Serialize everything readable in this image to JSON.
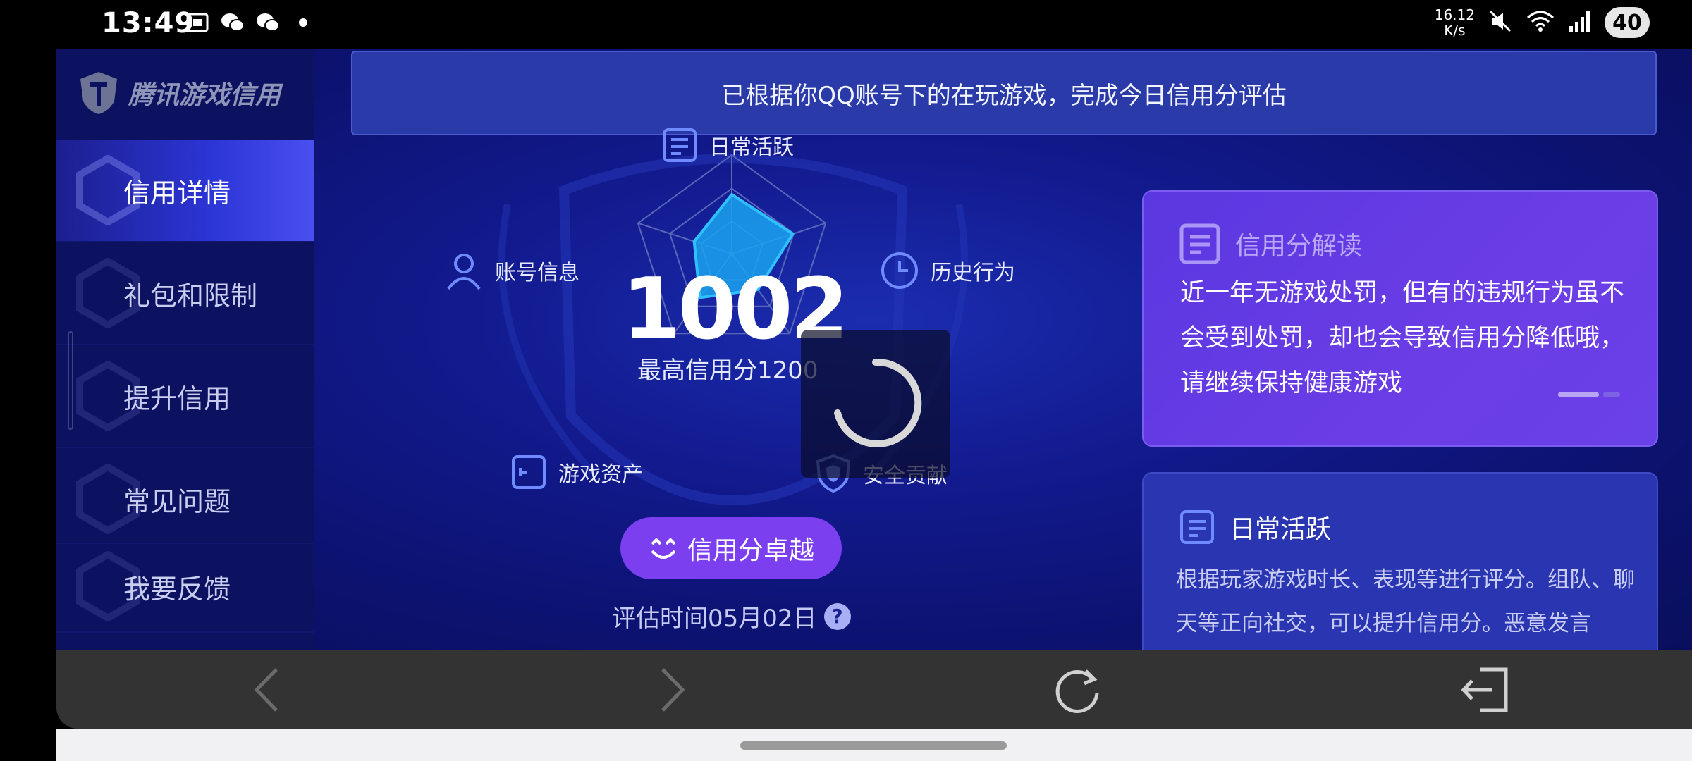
{
  "status_bar": {
    "time": "13:49",
    "net_speed_value": "16.12",
    "net_speed_unit": "K/s",
    "battery": "40",
    "icons": [
      "screenshot-icon",
      "wechat-icon",
      "wechat-icon",
      "dot-icon",
      "mute-icon",
      "wifi-icon",
      "signal-icon"
    ]
  },
  "sidebar": {
    "logo_text": "腾讯游戏信用",
    "items": [
      {
        "label": "信用详情",
        "active": true
      },
      {
        "label": "礼包和限制",
        "active": false
      },
      {
        "label": "提升信用",
        "active": false
      },
      {
        "label": "常见问题",
        "active": false
      },
      {
        "label": "我要反馈",
        "active": false
      }
    ]
  },
  "banner": {
    "text": "已根据你QQ账号下的在玩游戏，完成今日信用分评估"
  },
  "radar": {
    "labels": {
      "top": "日常活跃",
      "right": "历史行为",
      "left": "账号信息",
      "bottom_left": "游戏资产",
      "bottom_right": "安全贡献"
    },
    "values": [
      0.6,
      0.65,
      0.45,
      0.55,
      0.4
    ],
    "score": "1002",
    "max_score_text": "最高信用分1200"
  },
  "excellent_button": {
    "label": "信用分卓越"
  },
  "evaluation": {
    "time_text": "评估时间05月02日",
    "help_symbol": "?"
  },
  "card_interpretation": {
    "title": "信用分解读",
    "body": "近一年无游戏处罚，但有的违规行为虽不会受到处罚，却也会导致信用分降低哦，请继续保持健康游戏"
  },
  "card_daily": {
    "title": "日常活跃",
    "body": "根据玩家游戏时长、表现等进行评分。组队、聊天等正向社交，可以提升信用分。恶意发言"
  },
  "browser_bar": {
    "buttons": [
      "back-icon",
      "forward-icon",
      "refresh-icon",
      "exit-icon"
    ]
  },
  "colors": {
    "accent_purple": "#7b3ff0",
    "radar_fill": "#1aa3f0",
    "app_bg": "#0d1272"
  }
}
